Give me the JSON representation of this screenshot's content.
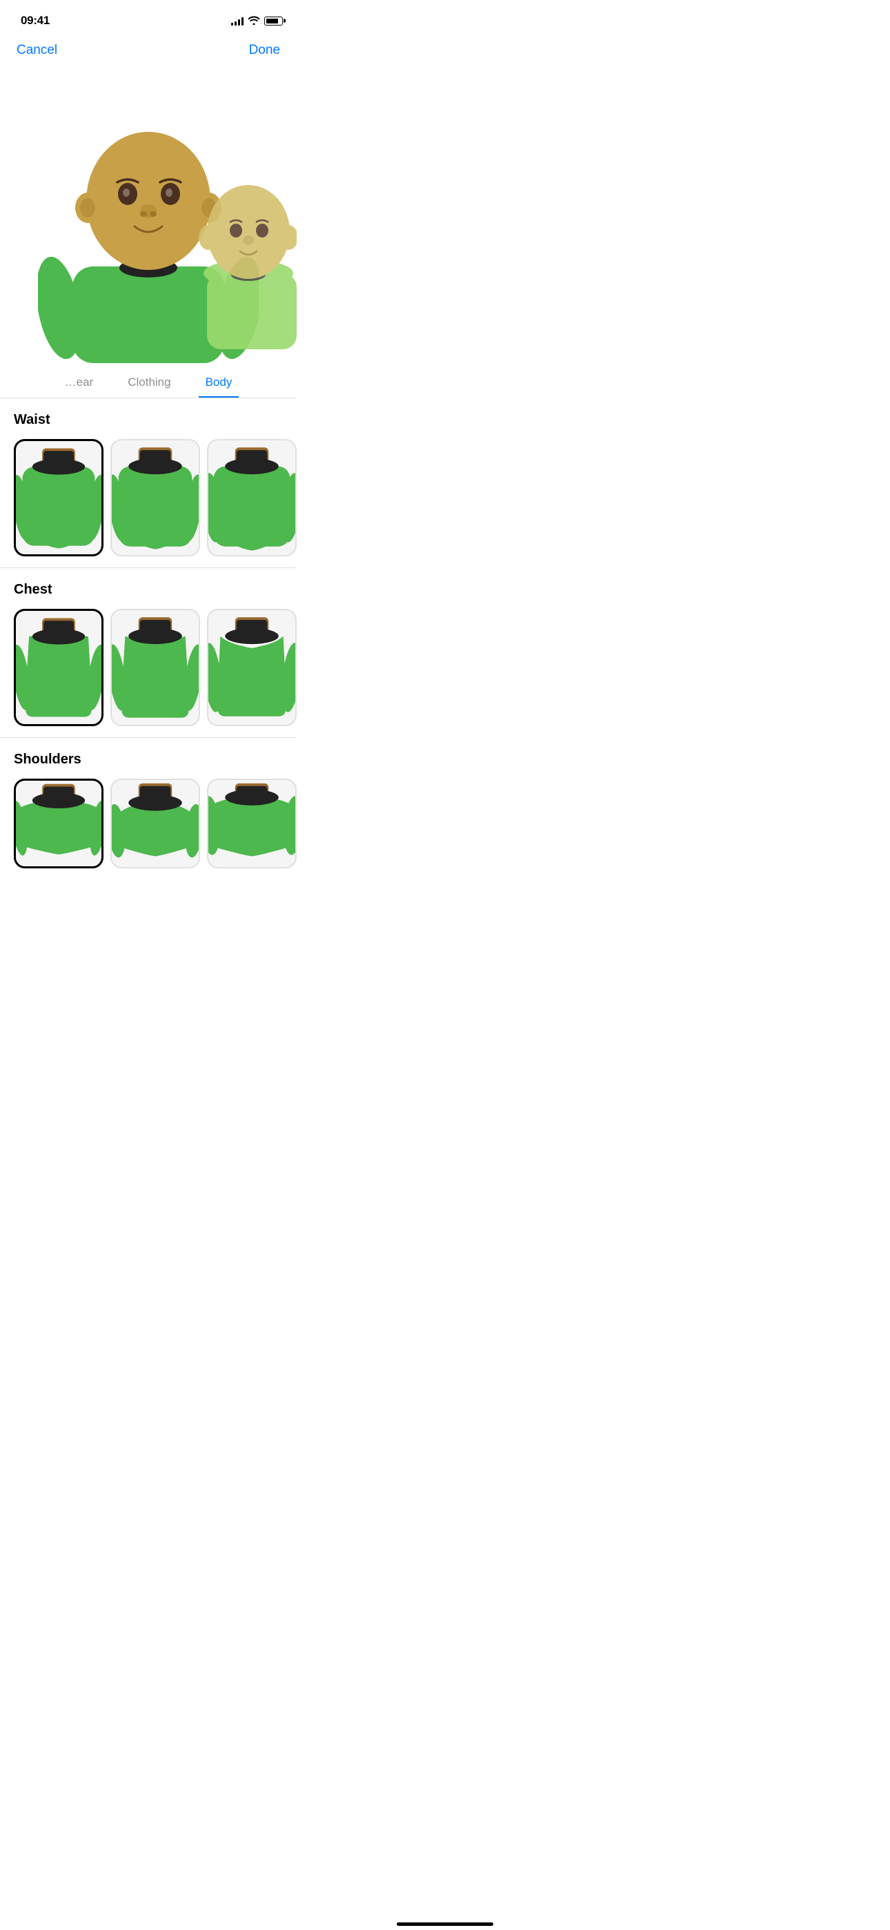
{
  "statusBar": {
    "time": "09:41",
    "signalBars": [
      3,
      5,
      7,
      9,
      11
    ],
    "battery": 80
  },
  "nav": {
    "cancel": "Cancel",
    "done": "Done"
  },
  "tabs": [
    {
      "id": "headwear",
      "label": "…ear",
      "active": false,
      "partial": true
    },
    {
      "id": "clothing",
      "label": "Clothing",
      "active": false
    },
    {
      "id": "body",
      "label": "Body",
      "active": true
    }
  ],
  "sections": [
    {
      "id": "waist",
      "title": "Waist",
      "options": [
        {
          "id": "waist-1",
          "selected": true
        },
        {
          "id": "waist-2",
          "selected": false
        },
        {
          "id": "waist-3",
          "selected": false
        }
      ]
    },
    {
      "id": "chest",
      "title": "Chest",
      "options": [
        {
          "id": "chest-1",
          "selected": true
        },
        {
          "id": "chest-2",
          "selected": false
        },
        {
          "id": "chest-3",
          "selected": false
        }
      ]
    },
    {
      "id": "shoulders",
      "title": "Shoulders",
      "options": [
        {
          "id": "shoulders-1",
          "selected": true
        },
        {
          "id": "shoulders-2",
          "selected": false
        },
        {
          "id": "shoulders-3",
          "selected": false
        }
      ]
    }
  ],
  "colors": {
    "accent": "#007AFF",
    "bodyGreen": "#5cb85c",
    "bodyGreenDark": "#4a9c3a",
    "collar": "#222",
    "neck": "#c8a048",
    "selected_border": "#000000"
  }
}
